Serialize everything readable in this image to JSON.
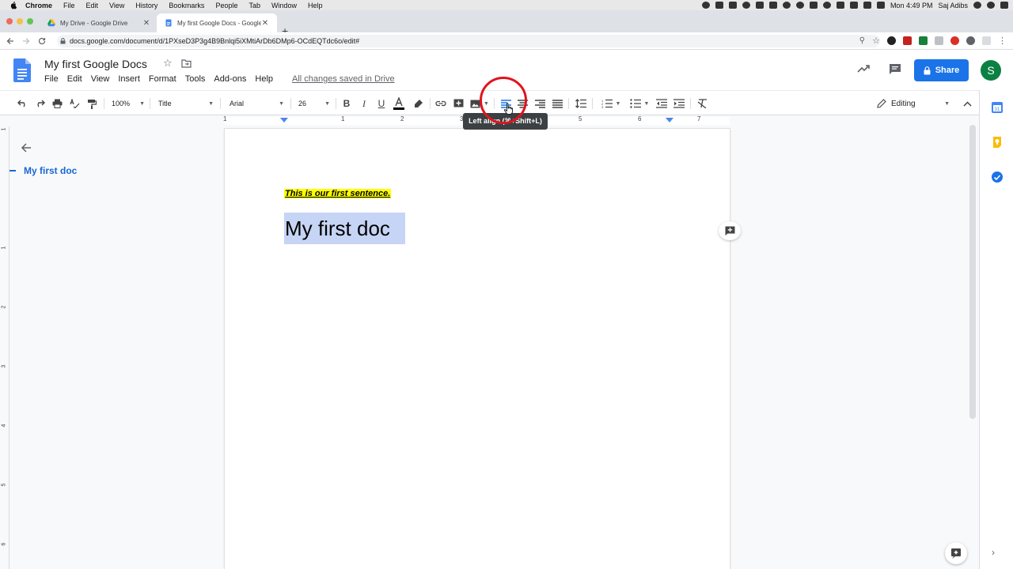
{
  "menubar": {
    "app": "Chrome",
    "items": [
      "File",
      "Edit",
      "View",
      "History",
      "Bookmarks",
      "People",
      "Tab",
      "Window",
      "Help"
    ],
    "clock": "Mon 4:49 PM",
    "user": "Saj Adibs"
  },
  "tabs": [
    {
      "title": "My Drive - Google Drive",
      "icon": "google-drive-icon"
    },
    {
      "title": "My first Google Docs - Google",
      "icon": "google-docs-icon"
    }
  ],
  "address": {
    "url": "docs.google.com/document/d/1PXseD3P3g4B9Bnlqi5iXMtiArDb6DMp6-OCdEQTdc6o/edit#"
  },
  "doc": {
    "title": "My first Google Docs",
    "menu": [
      "File",
      "Edit",
      "View",
      "Insert",
      "Format",
      "Tools",
      "Add-ons",
      "Help"
    ],
    "saved_status": "All changes saved in Drive",
    "share_label": "Share",
    "avatar_letter": "S"
  },
  "toolbar": {
    "zoom": "100%",
    "style": "Title",
    "font": "Arial",
    "size": "26",
    "mode": "Editing"
  },
  "tooltip": "Left align (⌘+Shift+L)",
  "outline": {
    "item": "My first doc"
  },
  "content": {
    "sentence": "This is our first sentence.",
    "heading": "My first doc"
  },
  "ruler": {
    "top_numbers": [
      "1",
      "1",
      "2",
      "3",
      "4",
      "5",
      "6",
      "7"
    ],
    "side_numbers": [
      "1",
      "1",
      "2",
      "3",
      "4",
      "5",
      "6"
    ]
  },
  "colors": {
    "accent": "#1a73e8",
    "selection": "#c6d4f5",
    "text_highlight": "#ffff00",
    "annotation_ring": "#e0141e",
    "avatar": "#0b8043"
  }
}
